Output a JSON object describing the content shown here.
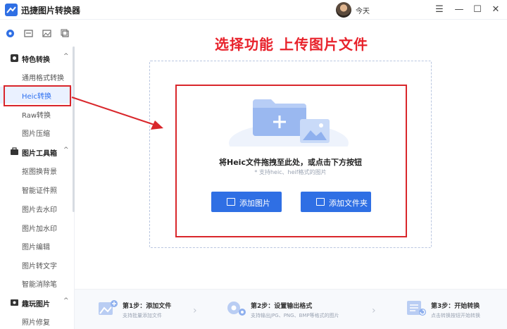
{
  "window": {
    "app_title": "迅捷图片转换器",
    "user_name": "今天",
    "controls": {
      "menu": "☰",
      "minimize": "—",
      "maximize": "☐",
      "close": "✕"
    }
  },
  "sidebar": {
    "groups": [
      {
        "label": "特色转换",
        "icon": "star-badge-icon",
        "items": [
          "通用格式转换",
          "Heic转换",
          "Raw转换",
          "图片压缩"
        ]
      },
      {
        "label": "图片工具箱",
        "icon": "toolbox-icon",
        "items": [
          "抠图换背景",
          "智能证件照",
          "图片去水印",
          "图片加水印",
          "图片编辑",
          "图片转文字",
          "智能消除笔"
        ]
      },
      {
        "label": "趣玩图片",
        "icon": "fun-image-icon",
        "items": [
          "照片修复"
        ]
      }
    ],
    "active_item": "Heic转换",
    "chevron": "^"
  },
  "annotation": {
    "headline": "选择功能 上传图片文件"
  },
  "dropzone": {
    "title": "将Heic文件拖拽至此处，或点击下方按钮",
    "hint": "* 支持heic、heif格式的图片",
    "add_image_label": "添加图片",
    "add_folder_label": "添加文件夹"
  },
  "steps": [
    {
      "title": "第1步：添加文件",
      "desc": "支持批量添加文件"
    },
    {
      "title": "第2步：设置输出格式",
      "desc": "支持输出JPG、PNG、BMP等格式的图片"
    },
    {
      "title": "第3步：开始转换",
      "desc": "点击转换按钮开始转换"
    }
  ],
  "colors": {
    "accent": "#2f6fe4",
    "annotation_red": "#d9262b",
    "active_bg": "#eaf1ff"
  }
}
